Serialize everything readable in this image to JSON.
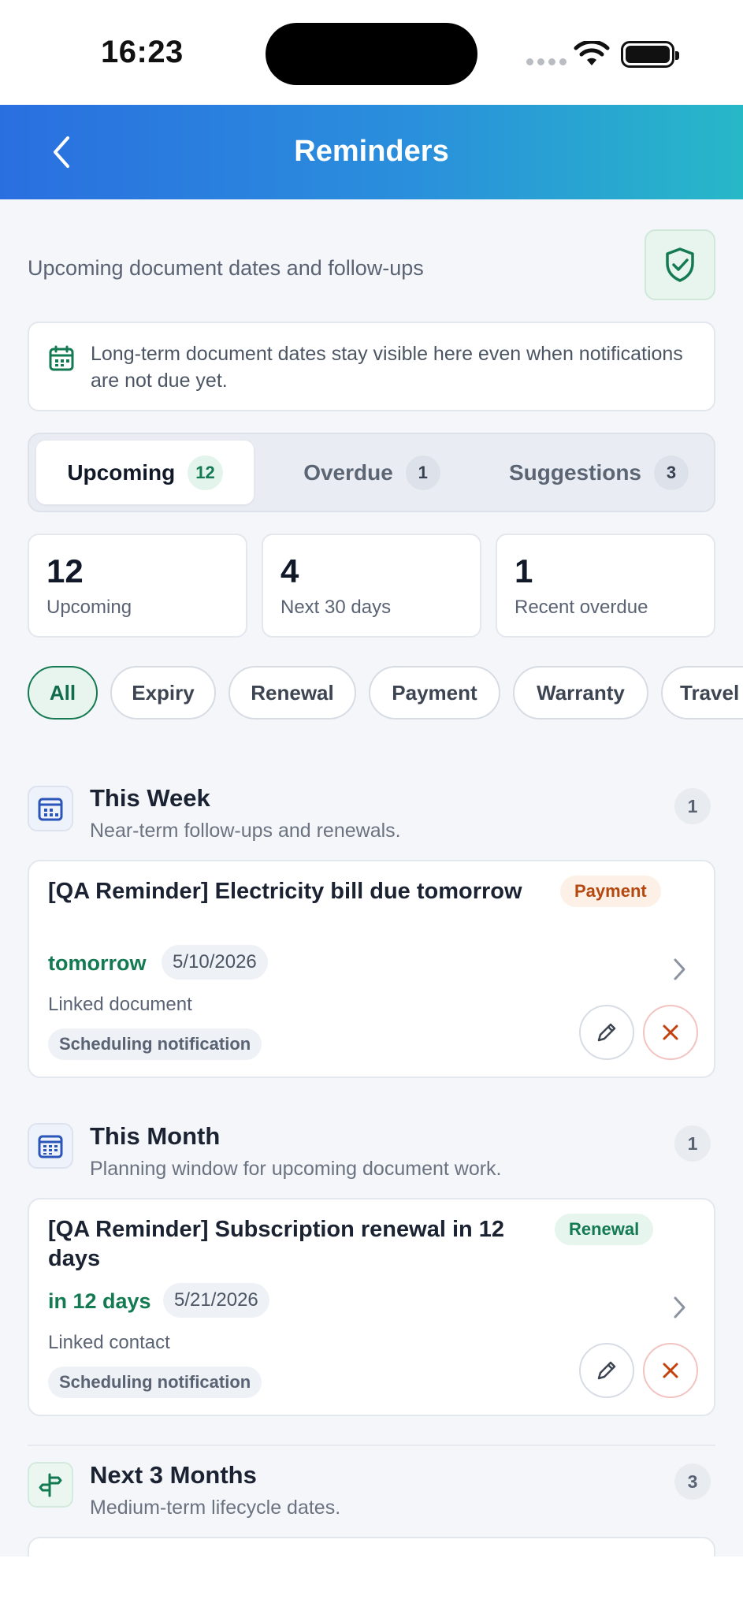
{
  "status_bar": {
    "time": "16:23"
  },
  "header": {
    "title": "Reminders"
  },
  "subtitle": "Upcoming document dates and follow-ups",
  "info": {
    "text": "Long-term document dates stay visible here even when notifications are not due yet."
  },
  "tabs": [
    {
      "label": "Upcoming",
      "count": "12",
      "active": true
    },
    {
      "label": "Overdue",
      "count": "1",
      "active": false
    },
    {
      "label": "Suggestions",
      "count": "3",
      "active": false
    }
  ],
  "stats": [
    {
      "value": "12",
      "label": "Upcoming"
    },
    {
      "value": "4",
      "label": "Next 30 days"
    },
    {
      "value": "1",
      "label": "Recent overdue"
    }
  ],
  "filters": [
    "All",
    "Expiry",
    "Renewal",
    "Payment",
    "Warranty",
    "Travel"
  ],
  "sections": [
    {
      "title": "This Week",
      "description": "Near-term follow-ups and renewals.",
      "count": "1",
      "icon": "calendar-week-icon",
      "card": {
        "title": "[QA Reminder] Electricity bill due tomorrow",
        "tag": "Payment",
        "when": "tomorrow",
        "date": "5/10/2026",
        "linked": "Linked document",
        "status": "Scheduling notification"
      }
    },
    {
      "title": "This Month",
      "description": "Planning window for upcoming document work.",
      "count": "1",
      "icon": "calendar-month-icon",
      "card": {
        "title": "[QA Reminder] Subscription renewal in 12 days",
        "tag": "Renewal",
        "when": "in 12 days",
        "date": "5/21/2026",
        "linked": "Linked contact",
        "status": "Scheduling notification"
      }
    },
    {
      "title": "Next 3 Months",
      "description": "Medium-term lifecycle dates.",
      "count": "3",
      "icon": "signpost-icon"
    }
  ],
  "colors": {
    "accent": "#137a52",
    "header_start": "#2a6fe0",
    "header_end": "#27b8c8",
    "payment_tag": "#b4480f",
    "delete": "#c2410c"
  }
}
